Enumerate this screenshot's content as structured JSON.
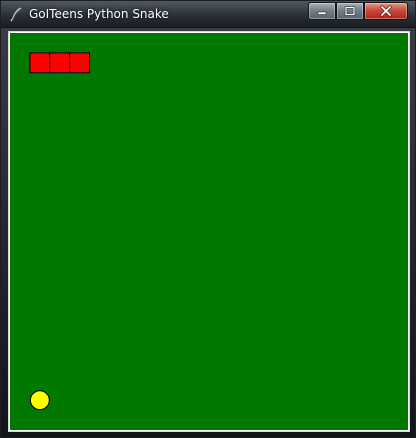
{
  "window": {
    "title": "GoITeens Python Snake",
    "icon": "feather-icon",
    "controls": [
      "minimize-icon",
      "maximize-icon",
      "close-icon"
    ]
  },
  "game": {
    "grid": {
      "cols": 20,
      "rows": 20
    },
    "snake": {
      "color": "#ff0000",
      "outline": "#000000",
      "cells": [
        {
          "col": 1,
          "row": 1
        },
        {
          "col": 2,
          "row": 1
        },
        {
          "col": 3,
          "row": 1
        }
      ]
    },
    "food": {
      "color": "#ffff00",
      "outline": "#000000",
      "cell": {
        "col": 1,
        "row": 18
      }
    },
    "board_color": "#007800"
  }
}
